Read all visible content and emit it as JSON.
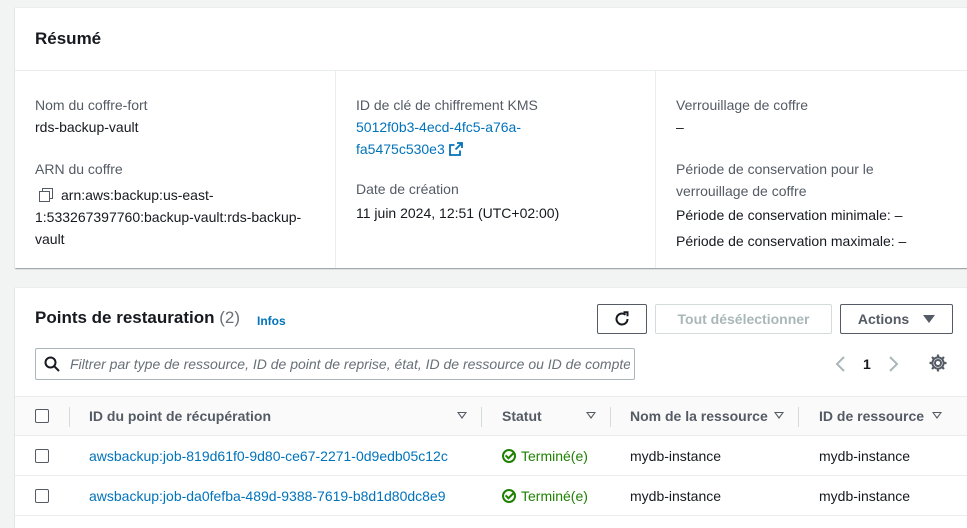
{
  "summary": {
    "title": "Résumé",
    "vault_name_label": "Nom du coffre-fort",
    "vault_name": "rds-backup-vault",
    "arn_label": "ARN du coffre",
    "arn_line1": "arn:aws:backup:us-east-",
    "arn_line2": "1:533267397760:backup-vault:rds-backup-",
    "arn_line3": "vault",
    "kms_label": "ID de clé de chiffrement KMS",
    "kms_line1": "5012f0b3-4ecd-4fc5-a76a-",
    "kms_line2": "fa5475c530e3",
    "created_label": "Date de création",
    "created_value": "11 juin 2024, 12:51 (UTC+02:00)",
    "lock_label": "Verrouillage de coffre",
    "lock_value": "–",
    "retention_label_1": "Période de conservation pour le",
    "retention_label_2": "verrouillage de coffre",
    "retention_min": "Période de conservation minimale: –",
    "retention_max": "Période de conservation maximale: –"
  },
  "points": {
    "title": "Points de restauration",
    "count": "(2)",
    "infos": "Infos",
    "deselect_label": "Tout désélectionner",
    "actions_label": "Actions",
    "search_placeholder": "Filtrer par type de ressource, ID de point de reprise, état, ID de ressource ou ID de compte source",
    "page": "1",
    "columns": {
      "id": "ID du point de récupération",
      "status": "Statut",
      "resource_name": "Nom de la ressource",
      "resource_id": "ID de ressource"
    },
    "rows": [
      {
        "id": "awsbackup:job-819d61f0-9d80-ce67-2271-0d9edb05c12c",
        "status": "Terminé(e)",
        "resource_name": "mydb-instance",
        "resource_id": "mydb-instance"
      },
      {
        "id": "awsbackup:job-da0fefba-489d-9388-7619-b8d1d80dc8e9",
        "status": "Terminé(e)",
        "resource_name": "mydb-instance",
        "resource_id": "mydb-instance"
      }
    ]
  },
  "colors": {
    "link": "#0073bb",
    "success": "#1d8102",
    "text": "#16191f",
    "muted": "#545b64"
  }
}
